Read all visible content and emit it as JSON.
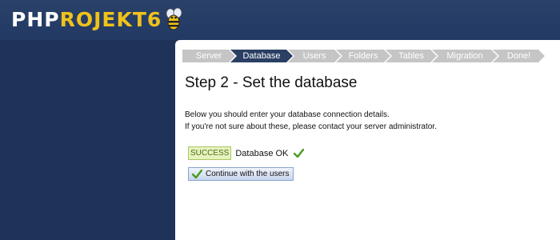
{
  "logo": {
    "part1": "PHP",
    "part2": "ROJEKT6"
  },
  "steps": [
    {
      "label": "Server",
      "active": false
    },
    {
      "label": "Database",
      "active": true
    },
    {
      "label": "Users",
      "active": false
    },
    {
      "label": "Folders",
      "active": false
    },
    {
      "label": "Tables",
      "active": false
    },
    {
      "label": "Migration",
      "active": false
    },
    {
      "label": "Done!",
      "active": false
    }
  ],
  "main": {
    "title": "Step 2 - Set the database",
    "description_line1": "Below you should enter your database connection details.",
    "description_line2": "If you're not sure about these, please contact your server administrator.",
    "status": {
      "badge": "SUCCESS",
      "text": "Database OK",
      "icon": "checkmark-icon"
    },
    "continue_button": {
      "label": "Continue with the users",
      "icon": "checkmark-icon"
    }
  },
  "colors": {
    "background": "#1f3359",
    "active_step": "#2a3f63",
    "inactive_step": "#c5c5c5",
    "logo_accent": "#f0c21a",
    "success_bg": "#e6f3bf",
    "check_green": "#4a9a1e"
  }
}
